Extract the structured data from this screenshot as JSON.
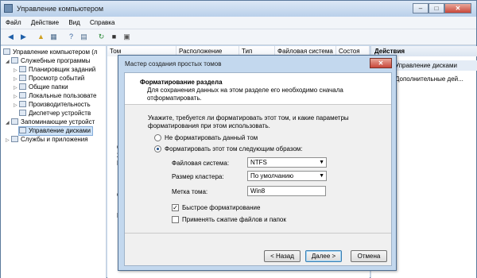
{
  "window": {
    "title": "Управление компьютером",
    "buttons": {
      "minimize": "–",
      "maximize": "□",
      "close": "✕"
    }
  },
  "menu": [
    "Файл",
    "Действие",
    "Вид",
    "Справка"
  ],
  "tree": {
    "root": "Управление компьютером (л",
    "utilities": "Служебные программы",
    "scheduler": "Планировщик заданий",
    "eventviewer": "Просмотр событий",
    "sharedfolders": "Общие папки",
    "localusers": "Локальные пользовате",
    "performance": "Производительность",
    "devmgr": "Диспетчер устройств",
    "storage": "Запоминающие устройст",
    "diskmgmt": "Управление дисками",
    "services": "Службы и приложения"
  },
  "columns": [
    "Том",
    "Расположение",
    "Тип",
    "Файловая система",
    "Состоя"
  ],
  "actions": {
    "header": "Действия",
    "item1": "Управление дисками",
    "item2": "Дополнительные дей..."
  },
  "stubs": [
    "С",
    "2(",
    "В",
    "С",
    "Н"
  ],
  "dialog": {
    "title": "Мастер создания простых томов",
    "close": "✕",
    "header_title": "Форматирование раздела",
    "header_desc": "Для сохранения данных на этом разделе его необходимо сначала отформатировать.",
    "prompt": "Укажите, требуется ли форматировать этот том, и какие параметры форматирования при этом использовать.",
    "radio_noformat": "Не форматировать данный том",
    "radio_format": "Форматировать этот том следующим образом:",
    "fs_label": "Файловая система:",
    "fs_value": "NTFS",
    "cluster_label": "Размер кластера:",
    "cluster_value": "По умолчанию",
    "volume_label": "Метка тома:",
    "volume_value": "Win8",
    "quick_format": "Быстрое форматирование",
    "compress": "Применять сжатие файлов и папок",
    "back": "< Назад",
    "next": "Далее >",
    "cancel": "Отмена"
  }
}
